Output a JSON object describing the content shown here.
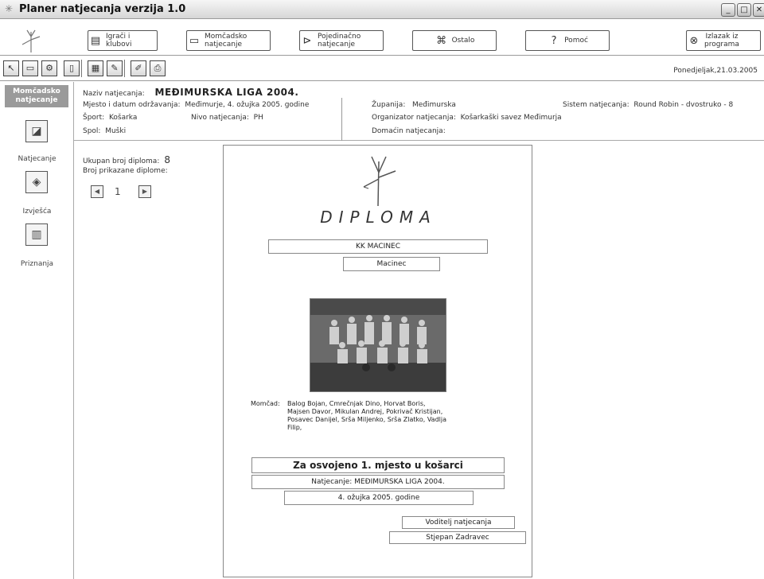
{
  "window": {
    "title": "Planer natjecanja verzija 1.0"
  },
  "nav": {
    "btn1": [
      "Igrači i",
      "klubovi"
    ],
    "btn2": [
      "Momčadsko",
      "natjecanje"
    ],
    "btn3": [
      "Pojedinačno",
      "natjecanje"
    ],
    "btn4": "Ostalo",
    "btn5": "Pomoć",
    "btn6": [
      "Izlazak iz",
      "programa"
    ]
  },
  "date": "Ponedjeljak,21.03.2005",
  "sidebar": {
    "header": [
      "Momčadsko",
      "natjecanje"
    ],
    "items": [
      "Natjecanje",
      "Izvješća",
      "Priznanja"
    ]
  },
  "info": {
    "naziv_label": "Naziv natjecanja:",
    "naziv_value": "MEĐIMURSKA LIGA 2004.",
    "mjesto_label": "Mjesto i datum održavanja:",
    "mjesto_value": "Međimurje, 4. ožujka 2005. godine",
    "sport_label": "Šport:",
    "sport_value": "Košarka",
    "nivo_label": "Nivo natjecanja:",
    "nivo_value": "PH",
    "spol_label": "Spol:",
    "spol_value": "Muški",
    "zupanija_label": "Županija:",
    "zupanija_value": "Međimurska",
    "organizator_label": "Organizator natjecanja:",
    "organizator_value": "Košarkaški savez Međimurja",
    "domacin_label": "Domaćin natjecanja:",
    "sistem_label": "Sistem natjecanja:",
    "sistem_value": "Round Robin - dvostruko - 8"
  },
  "counter": {
    "total_label": "Ukupan broj diploma:",
    "total_value": "8",
    "shown_label": "Broj prikazane diplome:",
    "current": "1"
  },
  "diploma": {
    "title": "DIPLOMA",
    "team_name": "KK MACINEC",
    "place": "Macinec",
    "team_label": "Momčad:",
    "players": "Balog Bojan, Cmrečnjak Dino, Horvat Boris, Majsen Davor, Mikulan Andrej, Pokrivač Kristijan, Posavec Danijel, Srša Miljenko, Srša Zlatko, Vadlja Filip,",
    "award": "Za osvojeno  1. mjesto u košarci",
    "competition": "Natjecanje: MEĐIMURSKA LIGA 2004.",
    "date": "4. ožujka 2005. godine",
    "leader_title": "Voditelj natjecanja",
    "leader_name": "Stjepan Zadravec"
  }
}
